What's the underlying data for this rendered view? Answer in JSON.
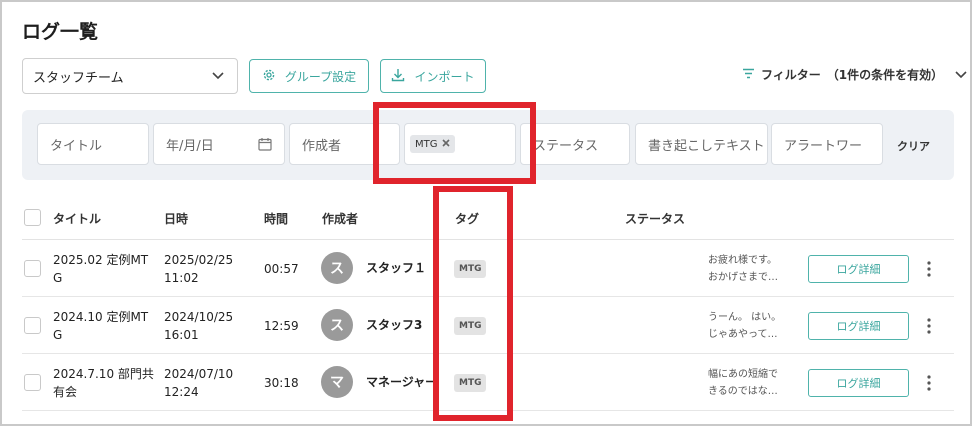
{
  "page": {
    "title": "ログ一覧"
  },
  "toolbar": {
    "team_select": "スタッフチーム",
    "group_settings": "グループ設定",
    "import": "インポート",
    "filter_toggle": "フィルター",
    "filter_status": "（1件の条件を有効）"
  },
  "filters": {
    "title_placeholder": "タイトル",
    "date_placeholder": "年/月/日",
    "author_placeholder": "作成者",
    "tag_chip": "MTG",
    "status_placeholder": "ステータス",
    "transcript_placeholder": "書き起こしテキスト",
    "alert_placeholder": "アラートワー",
    "clear": "クリア"
  },
  "table": {
    "headers": {
      "title": "タイトル",
      "datetime": "日時",
      "duration": "時間",
      "author": "作成者",
      "tag": "タグ",
      "status": "ステータス"
    },
    "detail_label": "ログ詳細",
    "rows": [
      {
        "title_l1": "2025.02 定例MT",
        "title_l2": "G",
        "date": "2025/02/25",
        "time": "11:02",
        "duration": "00:57",
        "avatar": "ス",
        "author": "スタッフ１",
        "tag": "MTG",
        "excerpt_l1": "お疲れ様です。",
        "excerpt_l2": "おかげさまで…"
      },
      {
        "title_l1": "2024.10 定例MT",
        "title_l2": "G",
        "date": "2024/10/25",
        "time": "16:01",
        "duration": "12:59",
        "avatar": "ス",
        "author": "スタッフ3",
        "tag": "MTG",
        "excerpt_l1": "うーん。 はい。",
        "excerpt_l2": "じゃあやって…"
      },
      {
        "title_l1": "2024.7.10 部門共",
        "title_l2": "有会",
        "date": "2024/07/10",
        "time": "12:24",
        "duration": "30:18",
        "avatar": "マ",
        "author": "マネージャー",
        "tag": "MTG",
        "excerpt_l1": "幅にあの短縮で",
        "excerpt_l2": "きるのではな…"
      }
    ]
  },
  "colors": {
    "accent": "#3aa69e",
    "highlight": "#e0242c",
    "panel": "#eef1f5"
  },
  "icons": [
    "chevron-down-icon",
    "gear-icon",
    "download-icon",
    "filter-icon",
    "calendar-icon",
    "close-icon",
    "kebab-menu-icon"
  ]
}
